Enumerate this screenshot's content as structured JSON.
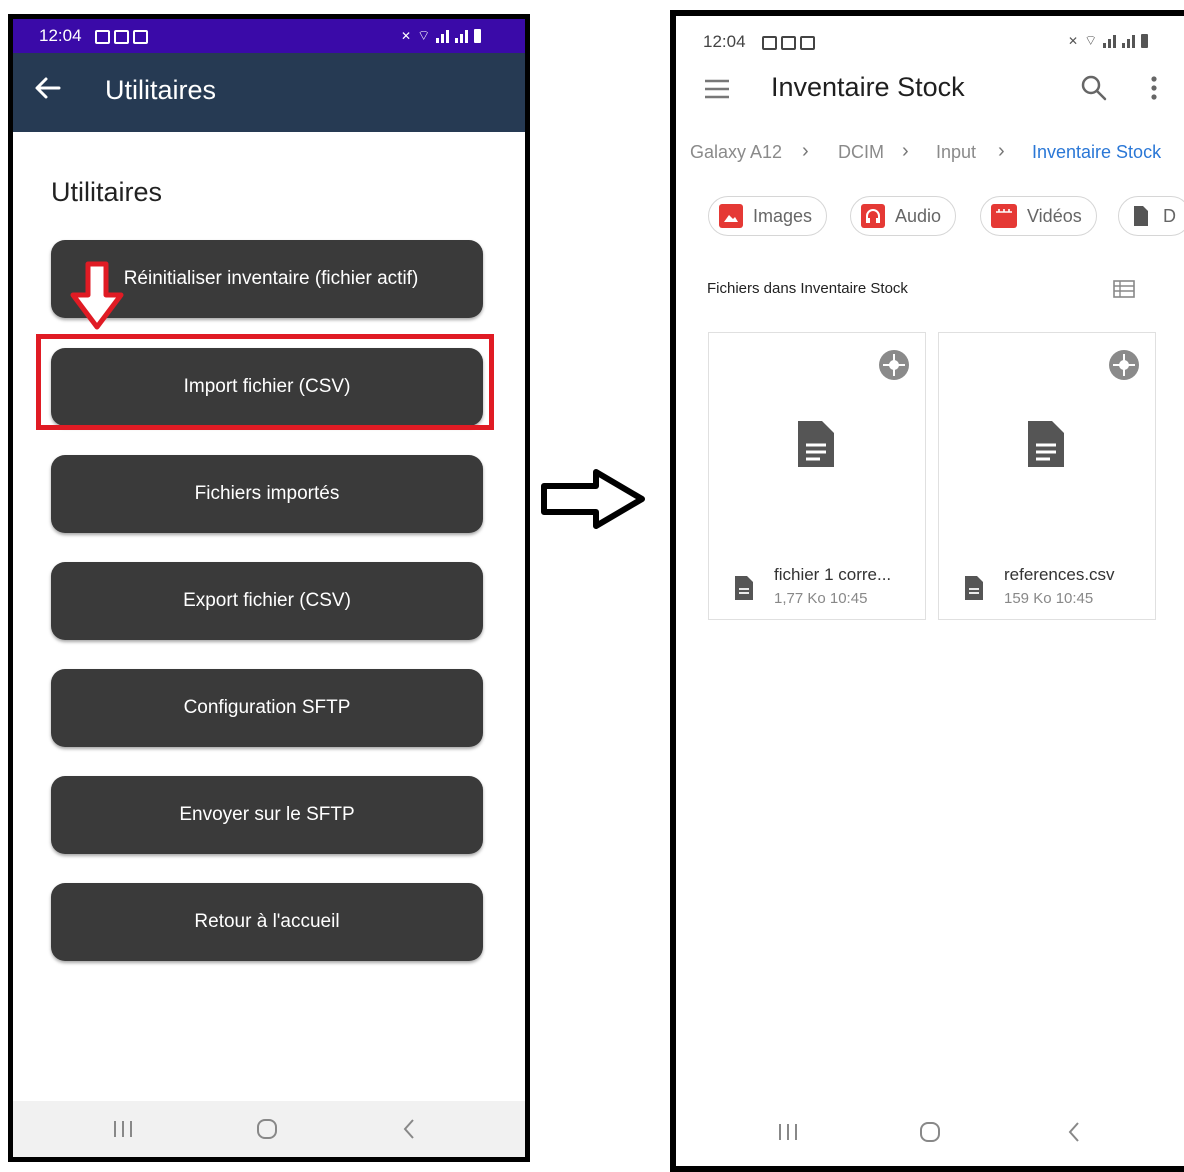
{
  "left_phone": {
    "status": {
      "time": "12:04"
    },
    "appbar": {
      "title": "Utilitaires"
    },
    "section_title": "Utilitaires",
    "buttons": [
      "Réinitialiser inventaire (fichier actif)",
      "Import fichier (CSV)",
      "Fichiers importés",
      "Export fichier (CSV)",
      "Configuration SFTP",
      "Envoyer sur le SFTP",
      "Retour à l'accueil"
    ],
    "highlight_color": "#e01b24",
    "status_color": "#3a0aa8",
    "appbar_color": "#263a53",
    "button_color": "#3a3a3a"
  },
  "right_phone": {
    "status": {
      "time": "12:04"
    },
    "title": "Inventaire Stock",
    "breadcrumb": [
      "Galaxy A12",
      "DCIM",
      "Input",
      "Inventaire Stock"
    ],
    "chips": [
      {
        "label": "Images",
        "icon": "image-icon",
        "color": "#e53935"
      },
      {
        "label": "Audio",
        "icon": "headphones-icon",
        "color": "#e53935"
      },
      {
        "label": "Vidéos",
        "icon": "video-icon",
        "color": "#e53935"
      },
      {
        "label": "D",
        "icon": "document-icon",
        "color": "#555555"
      }
    ],
    "files_header": "Fichiers dans Inventaire Stock",
    "files": [
      {
        "name": "fichier 1 corre...",
        "meta": "1,77 Ko 10:45"
      },
      {
        "name": "references.csv",
        "meta": "159 Ko 10:45"
      }
    ],
    "accent_color": "#2a77d6"
  }
}
